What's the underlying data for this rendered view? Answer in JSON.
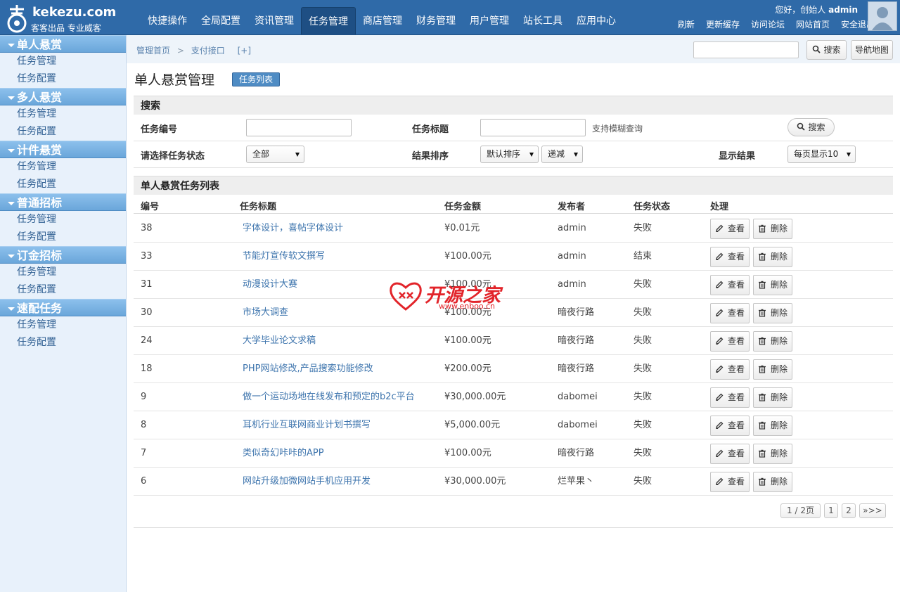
{
  "logo": {
    "brand": "kekezu.com",
    "sub": "客客出品 专业威客"
  },
  "nav": [
    "快捷操作",
    "全局配置",
    "资讯管理",
    "任务管理",
    "商店管理",
    "财务管理",
    "用户管理",
    "站长工具",
    "应用中心"
  ],
  "nav_active": "任务管理",
  "user": {
    "greeting": "您好，创始人",
    "name": "admin"
  },
  "toplinks": [
    "刷新",
    "更新缓存",
    "访问论坛",
    "网站首页",
    "安全退出"
  ],
  "sidebar": [
    {
      "title": "单人悬赏",
      "items": [
        "任务管理",
        "任务配置"
      ]
    },
    {
      "title": "多人悬赏",
      "items": [
        "任务管理",
        "任务配置"
      ]
    },
    {
      "title": "计件悬赏",
      "items": [
        "任务管理",
        "任务配置"
      ]
    },
    {
      "title": "普通招标",
      "items": [
        "任务管理",
        "任务配置"
      ]
    },
    {
      "title": "订金招标",
      "items": [
        "任务管理",
        "任务配置"
      ]
    },
    {
      "title": "速配任务",
      "items": [
        "任务管理",
        "任务配置"
      ]
    }
  ],
  "breadcrumb": {
    "home": "管理首页",
    "current": "支付接口",
    "add": "[+]"
  },
  "topbar_actions": {
    "search": "搜索",
    "navmap": "导航地图"
  },
  "page_title": "单人悬赏管理",
  "tasklist_button": "任务列表",
  "search_section": {
    "title": "搜索",
    "task_id_label": "任务编号",
    "task_title_label": "任务标题",
    "fuzzy_hint": "支持模糊查询",
    "search_button": "搜索",
    "status_label": "请选择任务状态",
    "status_value": "全部",
    "sort_label": "结果排序",
    "sort_value": "默认排序",
    "order_value": "递减",
    "display_label": "显示结果",
    "display_value": "每页显示10"
  },
  "list_section": {
    "title": "单人悬赏任务列表",
    "columns": [
      "编号",
      "任务标题",
      "任务金额",
      "发布者",
      "任务状态",
      "处理"
    ],
    "view_label": "查看",
    "delete_label": "删除",
    "rows": [
      {
        "id": "38",
        "title": "字体设计，喜帖字体设计",
        "amount": "¥0.01元",
        "publisher": "admin",
        "status": "失败"
      },
      {
        "id": "33",
        "title": "节能灯宣传软文撰写",
        "amount": "¥100.00元",
        "publisher": "admin",
        "status": "结束"
      },
      {
        "id": "31",
        "title": "动漫设计大赛",
        "amount": "¥100.00元",
        "publisher": "admin",
        "status": "失败"
      },
      {
        "id": "30",
        "title": "市场大调查",
        "amount": "¥100.00元",
        "publisher": "暗夜行路",
        "status": "失败"
      },
      {
        "id": "24",
        "title": "大学毕业论文求稿",
        "amount": "¥100.00元",
        "publisher": "暗夜行路",
        "status": "失败"
      },
      {
        "id": "18",
        "title": "PHP网站修改,产品搜索功能修改",
        "amount": "¥200.00元",
        "publisher": "暗夜行路",
        "status": "失败"
      },
      {
        "id": "9",
        "title": "做一个运动场地在线发布和预定的b2c平台",
        "amount": "¥30,000.00元",
        "publisher": "dabomei",
        "status": "失败"
      },
      {
        "id": "8",
        "title": "耳机行业互联网商业计划书撰写",
        "amount": "¥5,000.00元",
        "publisher": "dabomei",
        "status": "失败"
      },
      {
        "id": "7",
        "title": "类似奇幻咔咔的APP",
        "amount": "¥100.00元",
        "publisher": "暗夜行路",
        "status": "失败"
      },
      {
        "id": "6",
        "title": "网站升级加微网站手机应用开发",
        "amount": "¥30,000.00元",
        "publisher": "烂苹果丶",
        "status": "失败"
      }
    ]
  },
  "pagination": {
    "summary": "1 / 2页",
    "pages": [
      "1",
      "2"
    ],
    "next": "»>>"
  },
  "watermark": {
    "text": "开源之家",
    "url": "www.enboo.cn"
  },
  "colors": {
    "topbar": "#2f6aa8",
    "accent": "#4f8cc4",
    "link": "#3d74ad",
    "watermark": "#e2242a"
  }
}
